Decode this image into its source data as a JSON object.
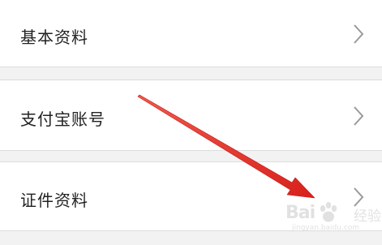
{
  "settings_list": {
    "items": [
      {
        "label": "基本资料",
        "icon": "chevron-right-icon"
      },
      {
        "label": "支付宝账号",
        "icon": "chevron-right-icon"
      },
      {
        "label": "证件资料",
        "icon": "chevron-right-icon"
      }
    ]
  },
  "annotation": {
    "arrow_color": "#e8312f"
  },
  "watermark": {
    "brand_prefix": "Bai",
    "brand_suffix": "经验",
    "url": "jingyan.baidu.com"
  },
  "colors": {
    "background": "#f2f2f2",
    "row_background": "#ffffff",
    "divider": "#dcdcdc",
    "text": "#222222",
    "chevron": "#9a9a9a"
  }
}
